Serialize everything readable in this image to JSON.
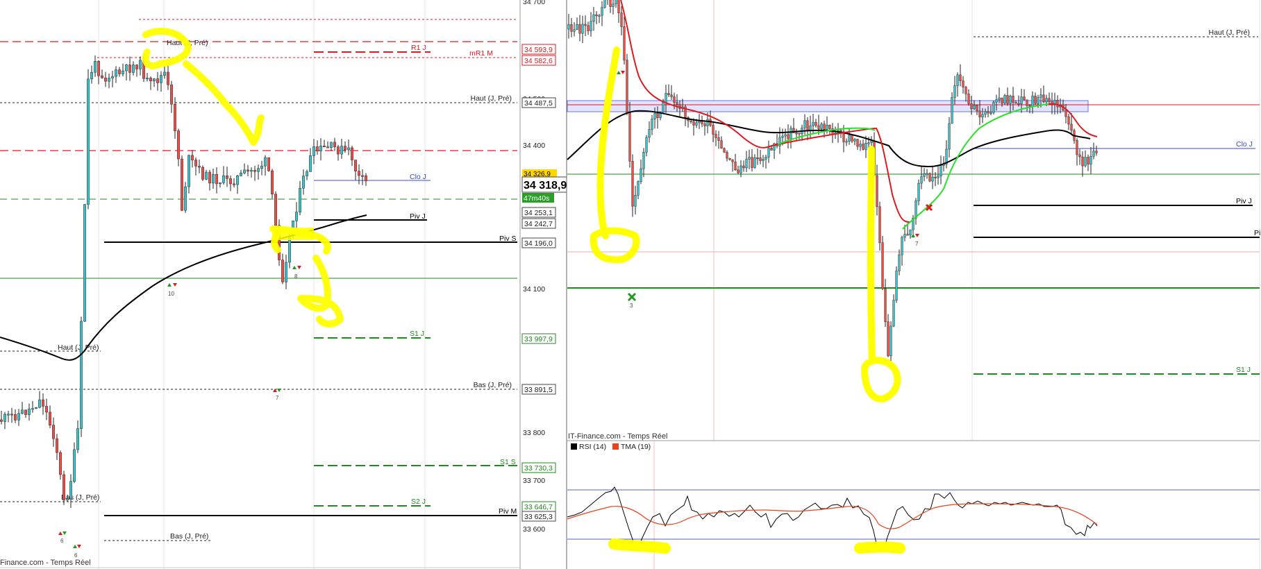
{
  "left_panel": {
    "footer": "Finance.com - Temps Réel",
    "price_box": "34 318,9",
    "countdown": "47m40s",
    "hidden_price": "34 326,9",
    "axis_ticks": [
      "34 700",
      "34 500",
      "34 400",
      "34 100",
      "33 800",
      "33 700",
      "33 600"
    ],
    "price_labels": [
      {
        "text": "34 593,9",
        "color": "#e0191e"
      },
      {
        "text": "34 582,6",
        "color": "#e0191e"
      },
      {
        "text": "34 487,5",
        "color": "#222222"
      },
      {
        "text": "34 253,1",
        "color": "#222222"
      },
      {
        "text": "34 242,7",
        "color": "#222222"
      },
      {
        "text": "34 196,0",
        "color": "#222222"
      },
      {
        "text": "33 997,9",
        "color": "#1f8a1f"
      },
      {
        "text": "33 891,5",
        "color": "#222222"
      },
      {
        "text": "33 730,3",
        "color": "#1f8a1f"
      },
      {
        "text": "33 646,7",
        "color": "#1f8a1f"
      },
      {
        "text": "33 625,3",
        "color": "#222222"
      }
    ],
    "level_labels": [
      "R1 J",
      "mR1 M",
      "Haut (J, Pré)",
      "Clo J",
      "Piv J",
      "Piv S",
      "S1 J",
      "Bas (J, Pré)",
      "S1 S",
      "S2 J",
      "Piv M",
      "Haut (J, Pré)",
      "Bas (J, Pré)",
      "Haut (J, Pré)",
      "Bas (J, Pré)"
    ],
    "signal_counts": [
      "10",
      "7",
      "8",
      "6",
      "6"
    ]
  },
  "right_panel": {
    "level_labels": [
      "Haut (J, Pré)",
      "Clo J",
      "Piv J",
      "Pi",
      "S1 J"
    ],
    "signal_counts": [
      "3",
      "7"
    ],
    "watermark": "IT-Finance.com - Temps Réel",
    "legend": [
      {
        "label": "RSI (14)",
        "color": "#000000"
      },
      {
        "label": "TMA (19)",
        "color": "#e8431a"
      }
    ]
  },
  "colors": {
    "bull_candle": "#3fc1c9",
    "bear_candle": "#e9504a",
    "support": "#1f8a1f",
    "resistance": "#e0191e",
    "highlight": "#ffff00",
    "moving_average": "#000000"
  },
  "chart_data": [
    {
      "type": "candlestick",
      "title": "",
      "ylim": [
        33550,
        34720
      ],
      "yticks": [
        34700,
        34500,
        34400,
        34100,
        33800,
        33700,
        33600
      ],
      "levels": [
        {
          "name": "R1 J",
          "value": 34593.9
        },
        {
          "name": "mR1 M",
          "value": 34582.6
        },
        {
          "name": "Haut (J, Pré)",
          "value": 34487.5
        },
        {
          "name": "Clo J",
          "value": 34326.9
        },
        {
          "name": "Piv J",
          "value": 34253.1
        },
        {
          "name": "Piv S",
          "value": 34196.0
        },
        {
          "name": "S1 J",
          "value": 33997.9
        },
        {
          "name": "Bas (J, Pré)",
          "value": 33891.5
        },
        {
          "name": "S1 S",
          "value": 33730.3
        },
        {
          "name": "S2 J",
          "value": 33646.7
        },
        {
          "name": "Piv M",
          "value": 33625.3
        }
      ],
      "last_price": 34318.9
    },
    {
      "type": "candlestick",
      "title": "",
      "levels": [
        "Haut (J, Pré)",
        "Clo J",
        "Piv J",
        "S1 J"
      ]
    },
    {
      "type": "line",
      "series": [
        {
          "name": "RSI (14)"
        },
        {
          "name": "TMA (19)"
        }
      ]
    }
  ]
}
